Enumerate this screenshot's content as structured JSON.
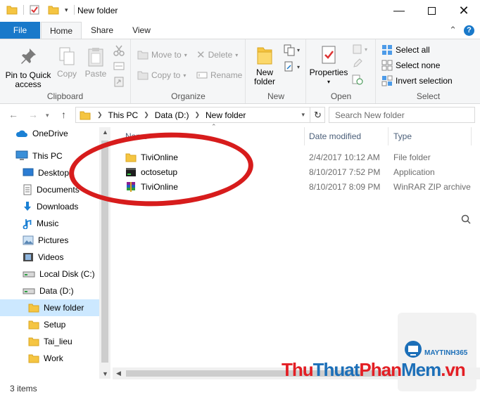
{
  "window": {
    "title": "New folder",
    "controls": [
      "minimize-icon",
      "maximize-icon",
      "close-icon"
    ]
  },
  "ribbon_tabs": [
    "File",
    "Home",
    "Share",
    "View"
  ],
  "ribbon": {
    "clipboard": {
      "label": "Clipboard",
      "pin_label": "Pin to Quick access",
      "copy_label": "Copy",
      "paste_label": "Paste"
    },
    "organize": {
      "label": "Organize",
      "move_to": "Move to",
      "copy_to": "Copy to",
      "delete": "Delete",
      "rename": "Rename"
    },
    "new": {
      "label": "New",
      "new_folder": "New folder"
    },
    "open": {
      "label": "Open",
      "properties": "Properties"
    },
    "select": {
      "label": "Select",
      "select_all": "Select all",
      "select_none": "Select none",
      "invert_selection": "Invert selection"
    }
  },
  "address": {
    "breadcrumb": [
      "This PC",
      "Data (D:)",
      "New folder"
    ],
    "search_placeholder": "Search New folder"
  },
  "nav_pane": {
    "items": [
      {
        "label": "OneDrive",
        "icon": "cloud-icon"
      },
      {
        "label": "This PC",
        "icon": "computer-icon"
      },
      {
        "label": "Desktop",
        "icon": "desktop-icon"
      },
      {
        "label": "Documents",
        "icon": "documents-icon"
      },
      {
        "label": "Downloads",
        "icon": "downloads-icon"
      },
      {
        "label": "Music",
        "icon": "music-icon"
      },
      {
        "label": "Pictures",
        "icon": "pictures-icon"
      },
      {
        "label": "Videos",
        "icon": "videos-icon"
      },
      {
        "label": "Local Disk (C:)",
        "icon": "drive-icon"
      },
      {
        "label": "Data (D:)",
        "icon": "drive-icon"
      },
      {
        "label": "New folder",
        "icon": "folder-icon"
      },
      {
        "label": "Setup",
        "icon": "folder-icon"
      },
      {
        "label": "Tai_lieu",
        "icon": "folder-icon"
      },
      {
        "label": "Work",
        "icon": "folder-icon"
      }
    ]
  },
  "file_list": {
    "columns": [
      "Name",
      "Date modified",
      "Type"
    ],
    "rows": [
      {
        "name": "TiviOnline",
        "date": "2/4/2017 10:12 AM",
        "type": "File folder",
        "icon": "folder-icon"
      },
      {
        "name": "octosetup",
        "date": "8/10/2017 7:52 PM",
        "type": "Application",
        "icon": "application-icon"
      },
      {
        "name": "TiviOnline",
        "date": "8/10/2017 8:09 PM",
        "type": "WinRAR ZIP archive",
        "icon": "winrar-icon"
      }
    ]
  },
  "status_bar": {
    "item_count": "3 items"
  },
  "watermark": {
    "text_1": "Thu",
    "text_2": "Thuat",
    "text_3": "Phan",
    "text_4": "Mem",
    "text_5": ".vn",
    "badge": "MAYTINH365"
  },
  "colors": {
    "file_tab": "#1979ca",
    "selection": "#cce8ff",
    "annotation": "#d71c1c"
  }
}
